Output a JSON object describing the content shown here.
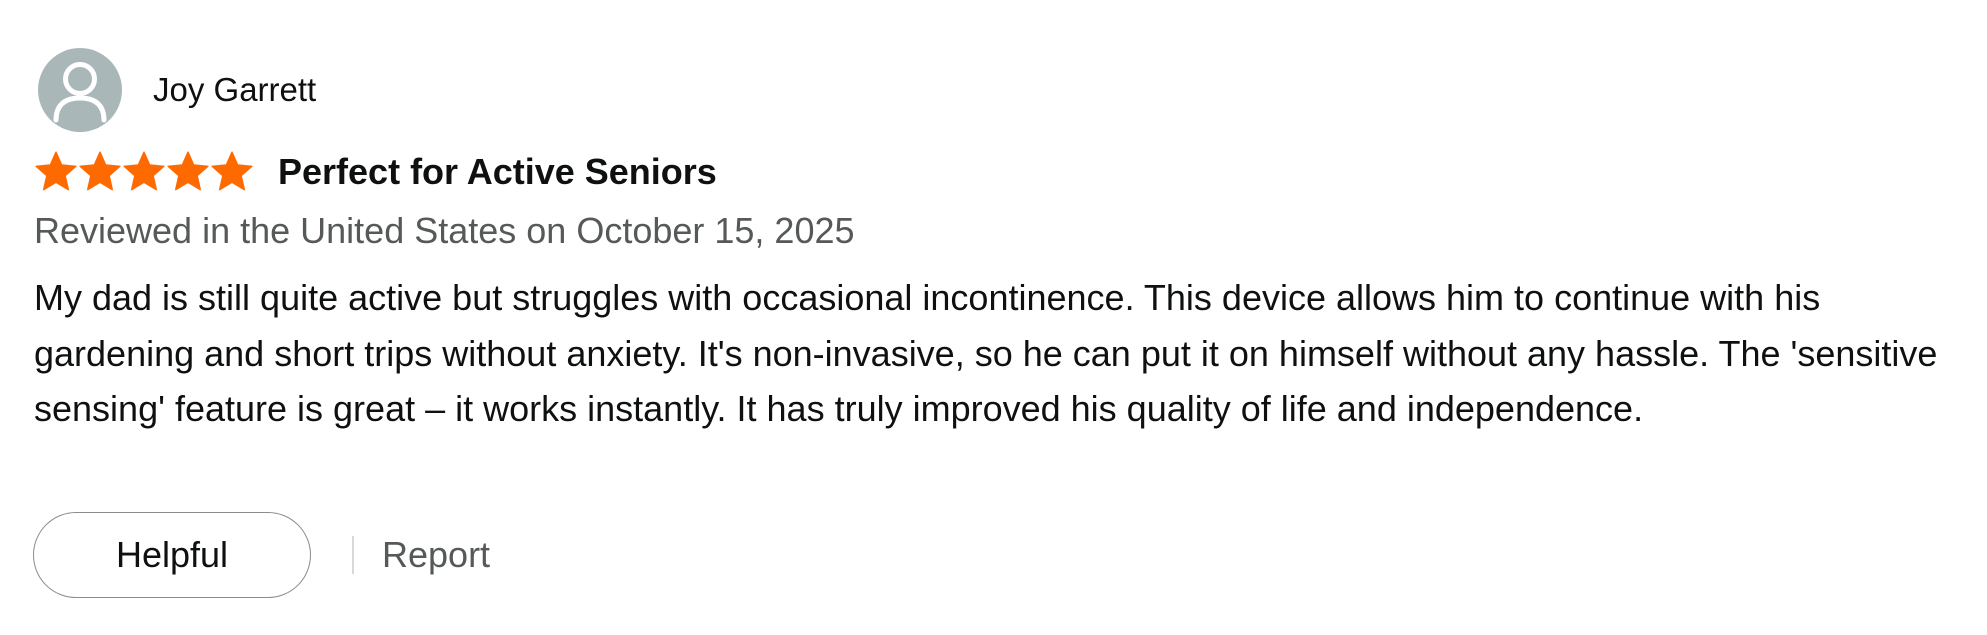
{
  "review": {
    "reviewer_name": "Joy Garrett",
    "rating": 5,
    "rating_max": 5,
    "star_color": "#ff6a00",
    "title": "Perfect for Active Seniors",
    "date_line": "Reviewed in the United States on October 15, 2025",
    "body": "My dad is still quite active but struggles with occasional incontinence. This device allows him to continue with his gardening and short trips without anxiety. It's non-invasive, so he can put it on himself without any hassle. The 'sensitive sensing' feature is great – it works instantly. It has truly improved his quality of life and independence.",
    "avatar_icon": "user-silhouette-icon"
  },
  "actions": {
    "helpful_label": "Helpful",
    "report_label": "Report"
  }
}
